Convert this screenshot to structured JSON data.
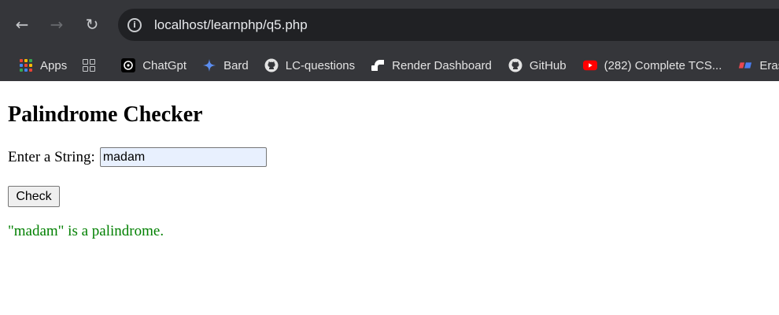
{
  "browser": {
    "url": "localhost/learnphp/q5.php",
    "back_icon": "arrow-left",
    "forward_icon": "arrow-right",
    "reload_icon": "reload",
    "info_icon": "info"
  },
  "bookmarks": [
    {
      "label": "Apps",
      "icon": "apps-grid"
    },
    {
      "label": "ChatGpt",
      "icon": "chatgpt"
    },
    {
      "label": "Bard",
      "icon": "sparkle"
    },
    {
      "label": "LC-questions",
      "icon": "github"
    },
    {
      "label": "Render Dashboard",
      "icon": "render"
    },
    {
      "label": "GitHub",
      "icon": "github"
    },
    {
      "label": "(282) Complete TCS...",
      "icon": "youtube"
    },
    {
      "label": "Eras",
      "icon": "eraser"
    }
  ],
  "page": {
    "heading": "Palindrome Checker",
    "input_label": "Enter a String:",
    "input_value": "madam",
    "button_label": "Check",
    "result_text": "\"madam\" is a palindrome.",
    "result_color": "#008000"
  }
}
